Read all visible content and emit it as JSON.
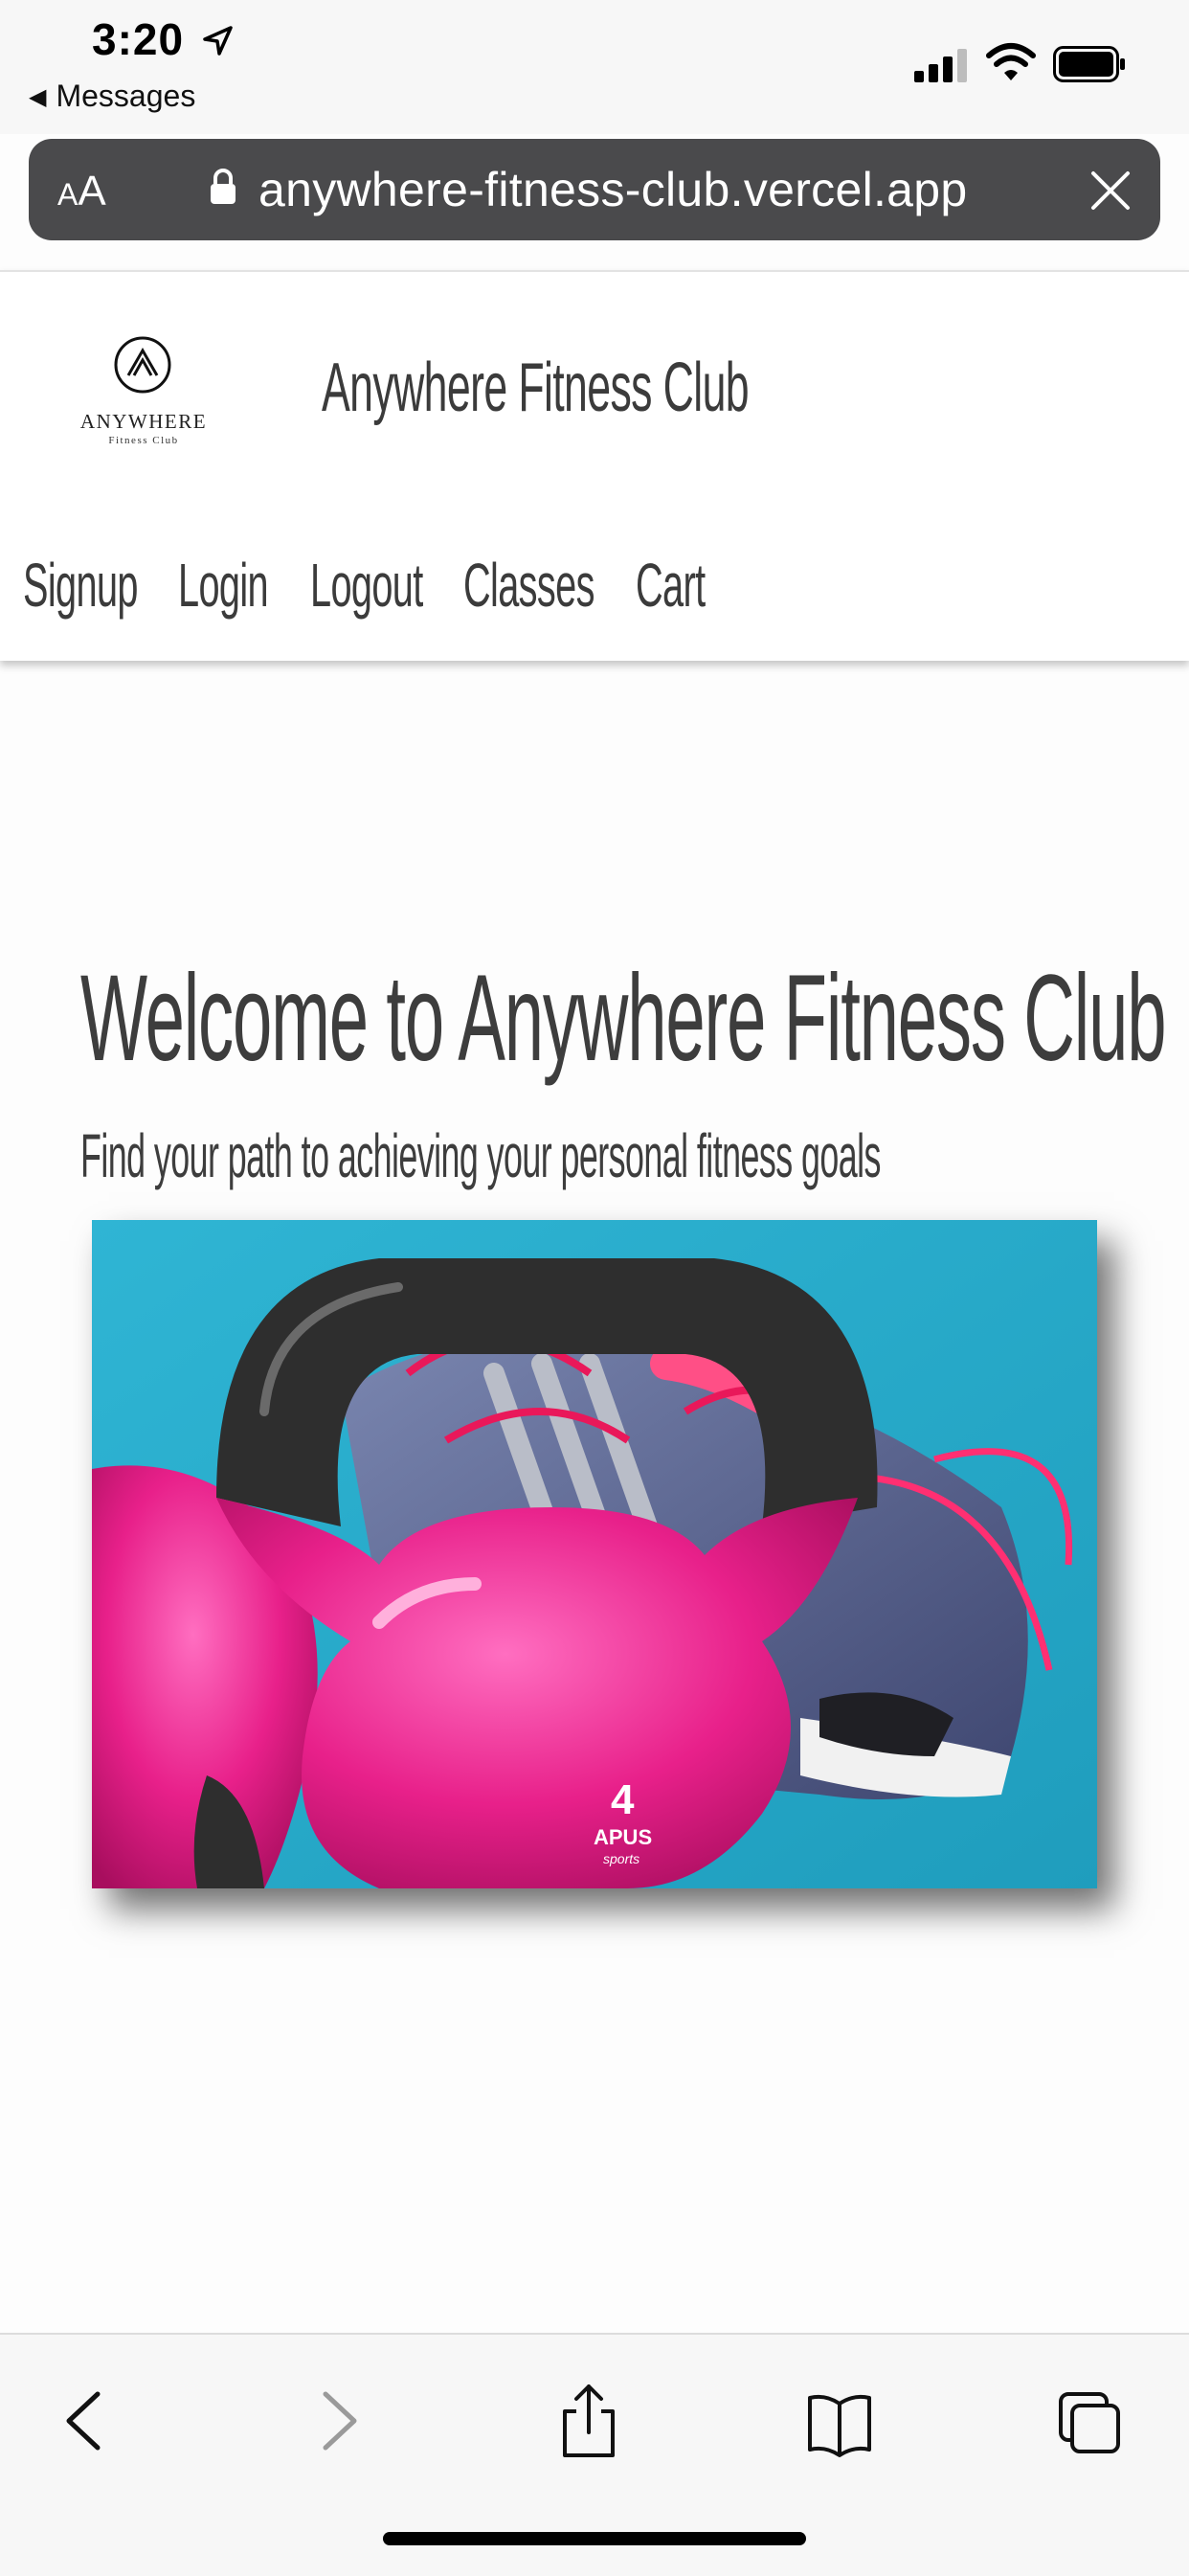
{
  "status_bar": {
    "time": "3:20",
    "back_label": "Messages"
  },
  "url_bar": {
    "text_size_label": "AA",
    "url": "anywhere-fitness-club.vercel.app"
  },
  "header": {
    "logo_word": "ANYWHERE",
    "logo_sub": "Fitness Club",
    "site_title": "Anywhere Fitness Club",
    "nav": [
      {
        "label": "Signup"
      },
      {
        "label": "Login"
      },
      {
        "label": "Logout"
      },
      {
        "label": "Classes"
      },
      {
        "label": "Cart"
      }
    ]
  },
  "main": {
    "heading": "Welcome to Anywhere Fitness Club",
    "tagline": "Find your path to achieving your personal fitness goals",
    "hero_image": {
      "kettlebell_weight": "4",
      "kettlebell_brand": "APUS",
      "kettlebell_brand_sub": "sports",
      "colors": {
        "background": "#34b4d0",
        "kettlebell": "#e8208a",
        "handle": "#2e2e2e",
        "shoe": "#5c6a99"
      }
    }
  },
  "toolbar": {
    "items": [
      "back-icon",
      "forward-icon",
      "share-icon",
      "bookmarks-icon",
      "tabs-icon"
    ]
  }
}
